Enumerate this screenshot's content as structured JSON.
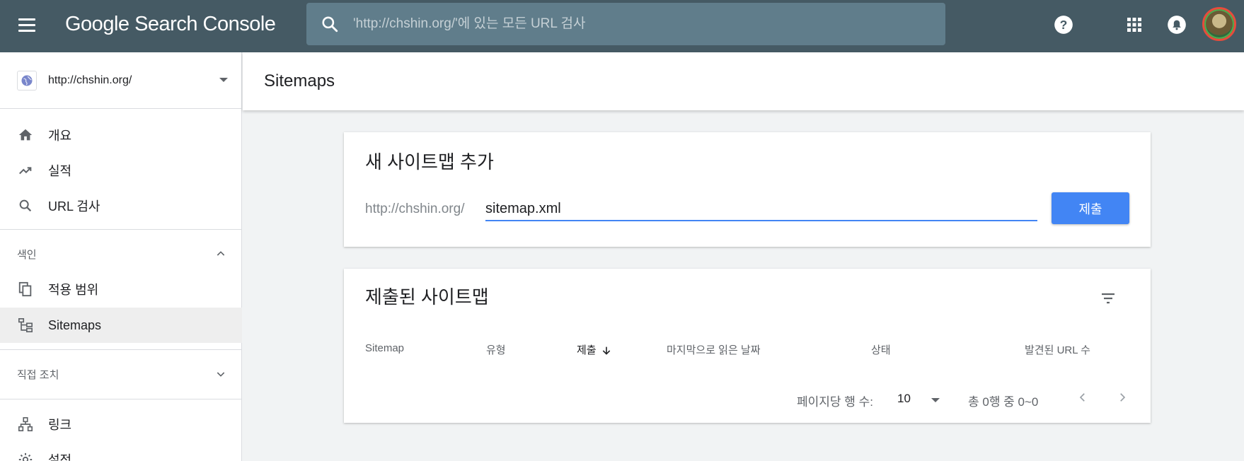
{
  "app": {
    "logo": "Google Search Console",
    "search_placeholder": "'http://chshin.org/'에 있는 모든 URL 검사"
  },
  "topbar_icons": [
    "menu-icon",
    "help-icon",
    "apps-icon",
    "notifications-icon",
    "avatar"
  ],
  "sidebar": {
    "property": "http://chshin.org/",
    "nav": [
      {
        "label": "개요",
        "icon": "home-icon"
      },
      {
        "label": "실적",
        "icon": "trending-up-icon"
      },
      {
        "label": "URL 검사",
        "icon": "search-icon"
      }
    ],
    "index_section": "색인",
    "index_items": [
      {
        "label": "적용 범위",
        "icon": "copy-icon"
      },
      {
        "label": "Sitemaps",
        "icon": "sitemap-icon",
        "active": true
      }
    ],
    "manual_section": "직접 조치",
    "more_items": [
      {
        "label": "링크",
        "icon": "links-icon"
      },
      {
        "label": "설정",
        "icon": "settings-icon"
      }
    ]
  },
  "main": {
    "page_title": "Sitemaps",
    "add_card": {
      "title": "새 사이트맵 추가",
      "url_prefix": "http://chshin.org/",
      "input_value": "sitemap.xml",
      "submit_label": "제출"
    },
    "submitted_card": {
      "title": "제출된 사이트맵",
      "columns": [
        "Sitemap",
        "유형",
        "제출",
        "마지막으로 읽은 날짜",
        "상태",
        "발견된 URL 수"
      ],
      "sorted_column": "제출",
      "rows_per_page_label": "페이지당 행 수:",
      "rows_per_page_value": "10",
      "range_label": "총 0행 중 0~0"
    }
  },
  "colors": {
    "topbar": "#455a64",
    "search_bg": "#607d8b",
    "accent": "#4285f4"
  }
}
